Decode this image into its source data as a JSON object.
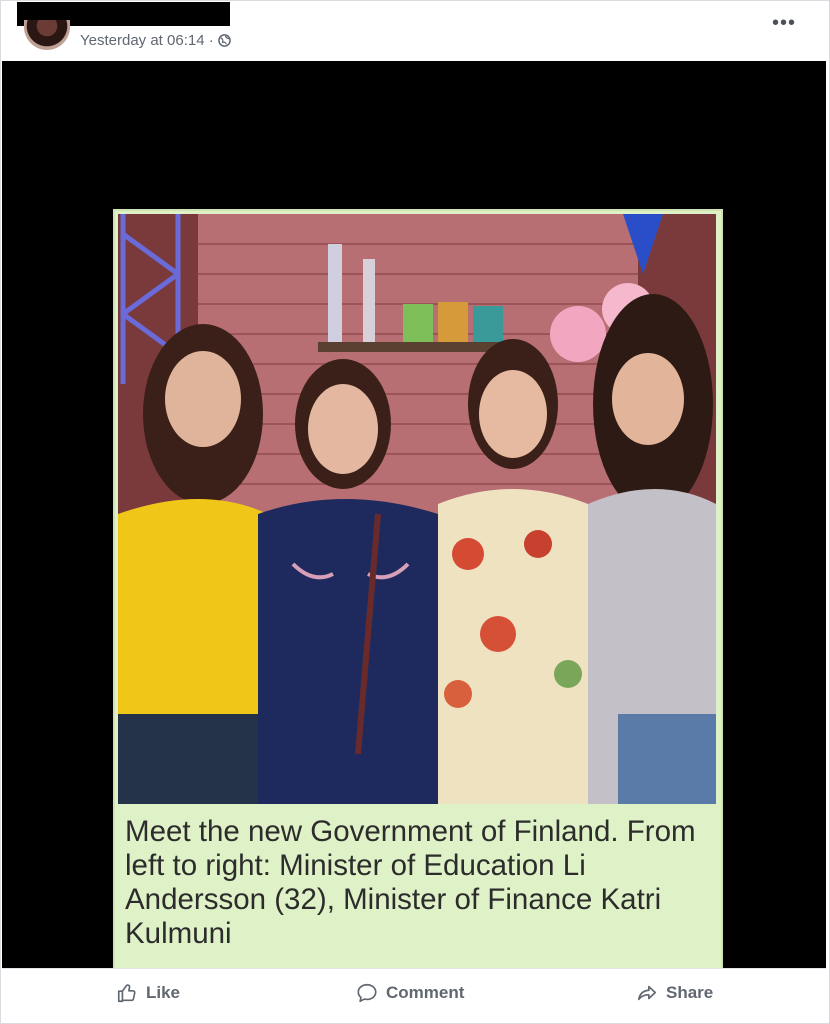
{
  "post": {
    "timestamp": "Yesterday at 06:14 ·",
    "privacy_icon": "globe-icon",
    "more_label": "•••"
  },
  "image": {
    "description_icon": "group-photo",
    "caption": "Meet the new Government of Finland. From left to right: Minister of Education Li Andersson (32), Minister of Finance Katri Kulmuni",
    "card_bg": "#dff1c6"
  },
  "actions": {
    "like_label": "Like",
    "comment_label": "Comment",
    "share_label": "Share"
  },
  "colors": {
    "meta_text": "#606770",
    "media_bg": "#000000"
  }
}
